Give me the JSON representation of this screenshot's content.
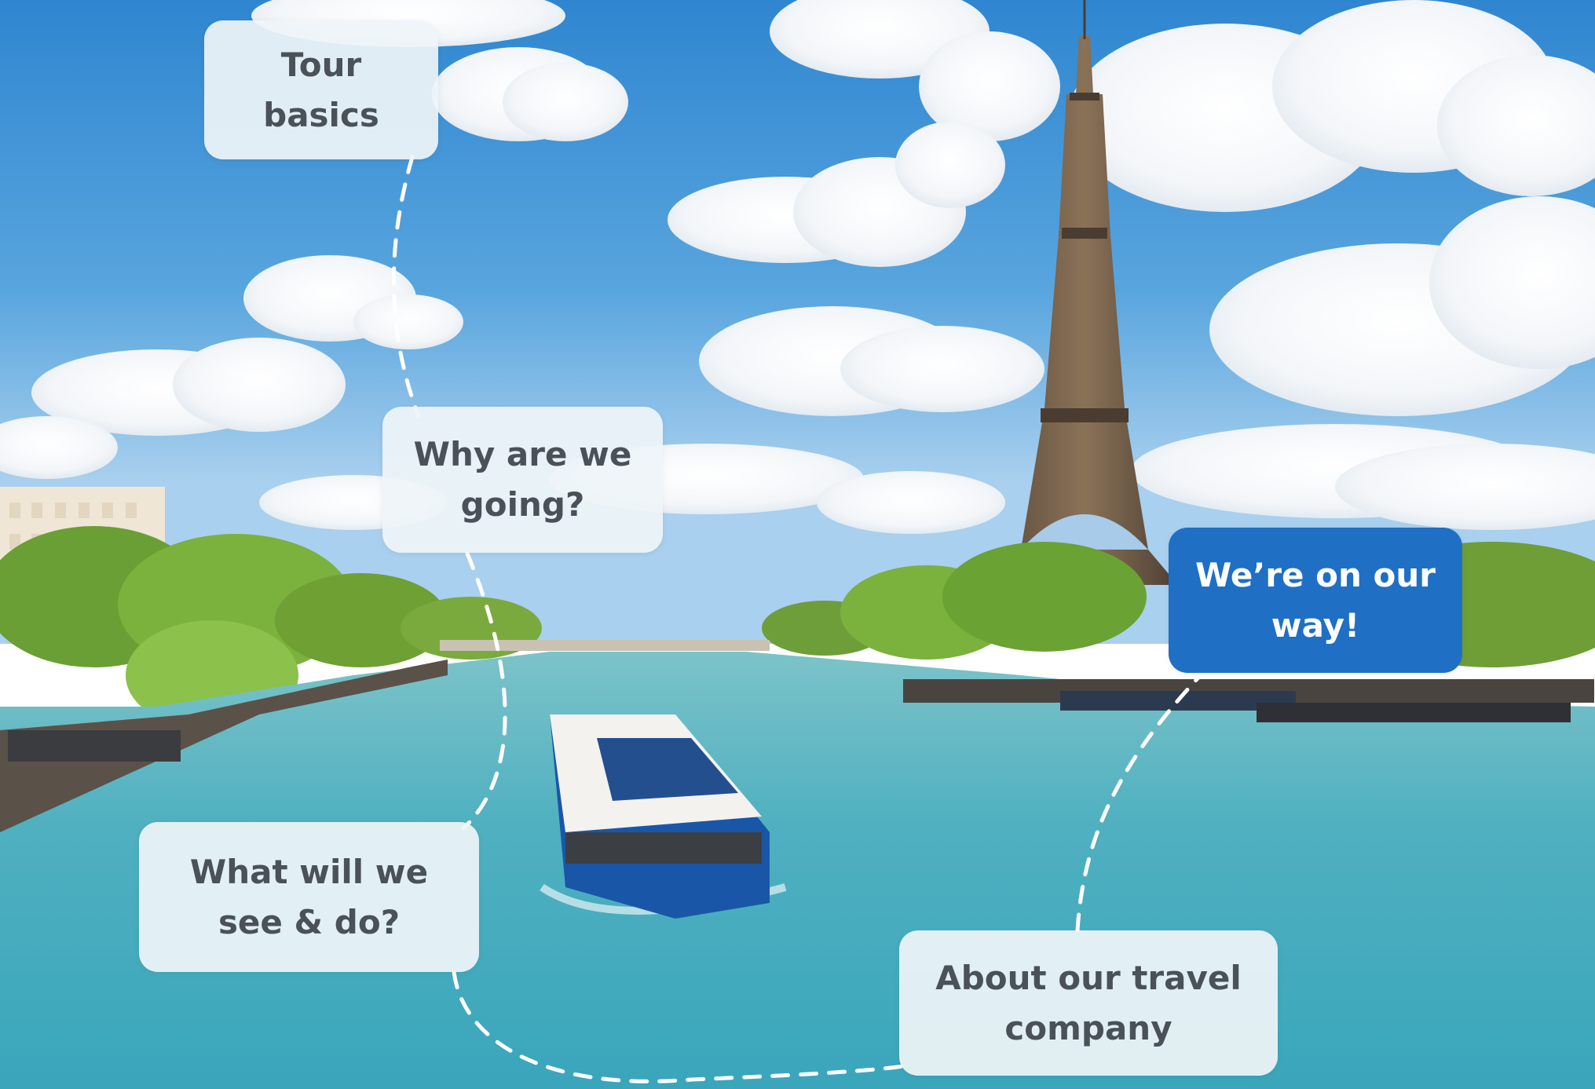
{
  "scene": {
    "description_icon": "paris-seine-eiffel-tower-photo",
    "colors": {
      "sky": "#4a97d6",
      "water": "#5fb6c3",
      "card_bg": "#eef4f8",
      "card_text": "#4a5159",
      "active_bg": "#1f6fc5",
      "active_text": "#ffffff",
      "path_dash": "#ffffff"
    }
  },
  "steps": [
    {
      "id": "tour-basics",
      "lines": [
        "Tour",
        "basics"
      ],
      "active": false
    },
    {
      "id": "why",
      "lines": [
        "Why are we",
        "going?"
      ],
      "active": false
    },
    {
      "id": "what",
      "lines": [
        "What will we",
        "see & do?"
      ],
      "active": false
    },
    {
      "id": "about",
      "lines": [
        "About our travel",
        "company"
      ],
      "active": false
    },
    {
      "id": "onway",
      "lines": [
        "We’re on our",
        "way!"
      ],
      "active": true
    }
  ]
}
